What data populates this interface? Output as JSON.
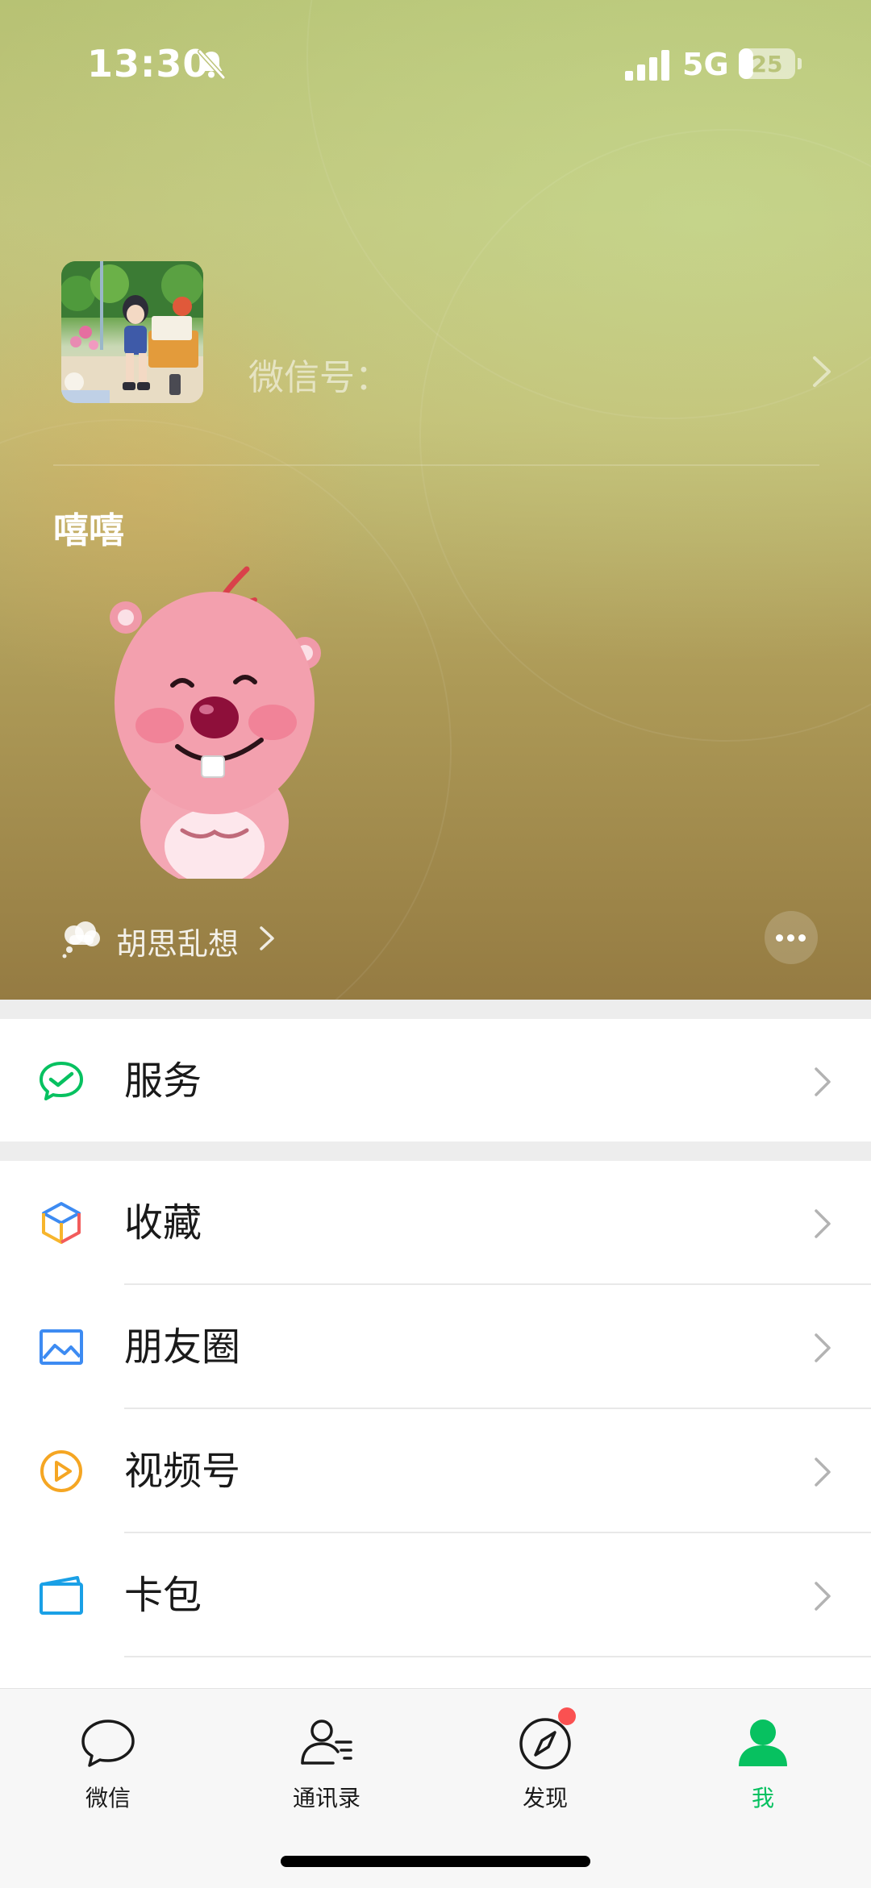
{
  "status_bar": {
    "time": "13:30",
    "network": "5G",
    "battery": "25",
    "battery_level": 0.25
  },
  "profile": {
    "wechat_id_label": "微信号：",
    "nickname": "嘻嘻",
    "status_text": "胡思乱想"
  },
  "menu": {
    "services": {
      "label": "服务",
      "icon": "wechat-pay-icon"
    },
    "items": [
      {
        "label": "收藏",
        "icon": "favorites-cube-icon"
      },
      {
        "label": "朋友圈",
        "icon": "moments-image-icon"
      },
      {
        "label": "视频号",
        "icon": "channels-play-icon"
      },
      {
        "label": "卡包",
        "icon": "card-wallet-icon"
      }
    ]
  },
  "tabbar": {
    "tabs": [
      {
        "label": "微信",
        "icon": "chat-bubble-icon"
      },
      {
        "label": "通讯录",
        "icon": "contacts-icon"
      },
      {
        "label": "发现",
        "icon": "compass-icon"
      },
      {
        "label": "我",
        "icon": "person-icon"
      }
    ],
    "active_tab": "我"
  },
  "colors": {
    "accent": "#07c160",
    "badge": "#fa5151",
    "page_background": "#ededed"
  }
}
